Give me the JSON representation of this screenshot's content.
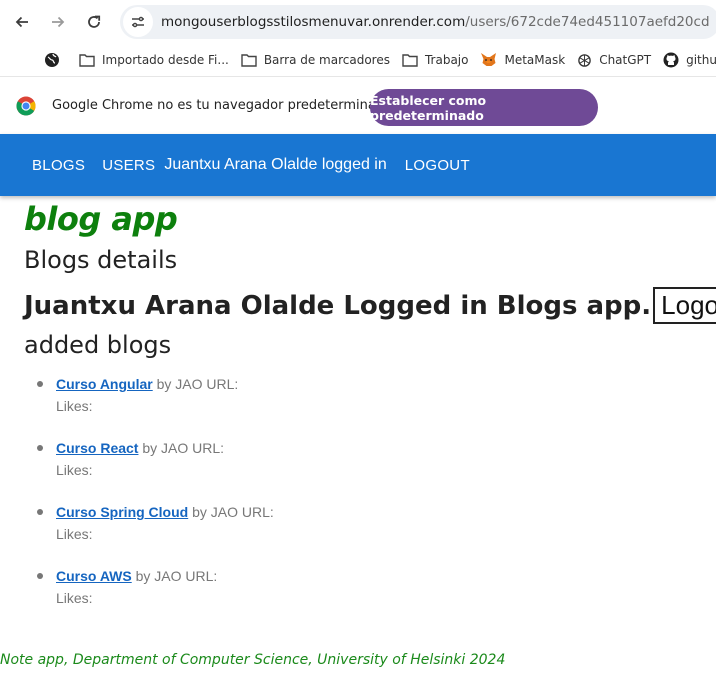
{
  "browser": {
    "url_host": "mongouserblogsstilosmenuvar.onrender.com",
    "url_path": "/users/672cde74ed451107aefd20cd",
    "bookmarks": [
      {
        "icon": "globe-icon",
        "label": ""
      },
      {
        "icon": "folder-icon",
        "label": "Importado desde Fi..."
      },
      {
        "icon": "folder-icon",
        "label": "Barra de marcadores"
      },
      {
        "icon": "folder-icon",
        "label": "Trabajo"
      },
      {
        "icon": "metamask-fox-icon",
        "label": "MetaMask"
      },
      {
        "icon": "chatgpt-icon",
        "label": "ChatGPT"
      },
      {
        "icon": "github-icon",
        "label": "github"
      }
    ],
    "infobar_message": "Google Chrome no es tu navegador predeterminado",
    "infobar_button": "Establecer como predeterminado",
    "infobar_button_color": "#6f4a96"
  },
  "appbar": {
    "color": "#1976d2",
    "blogs_label": "BLOGS",
    "users_label": "USERS",
    "user_status": "Juantxu Arana Olalde logged in",
    "logout_label": "LOGOUT"
  },
  "page": {
    "app_title": "blog app",
    "app_title_color": "#0d800d",
    "section_title": "Blogs details",
    "login_text": "Juantxu Arana Olalde Logged in Blogs app.",
    "logout_button": "Logout",
    "added_title": "added blogs",
    "blogs": [
      {
        "title": "Curso Angular",
        "author_text": "by JAO URL:",
        "likes_text": "Likes:"
      },
      {
        "title": "Curso React",
        "author_text": "by JAO URL:",
        "likes_text": "Likes:"
      },
      {
        "title": "Curso Spring Cloud",
        "author_text": "by JAO URL:",
        "likes_text": "Likes:"
      },
      {
        "title": "Curso AWS",
        "author_text": "by JAO URL:",
        "likes_text": "Likes:"
      }
    ],
    "footer": "Note app, Department of Computer Science, University of Helsinki 2024"
  }
}
